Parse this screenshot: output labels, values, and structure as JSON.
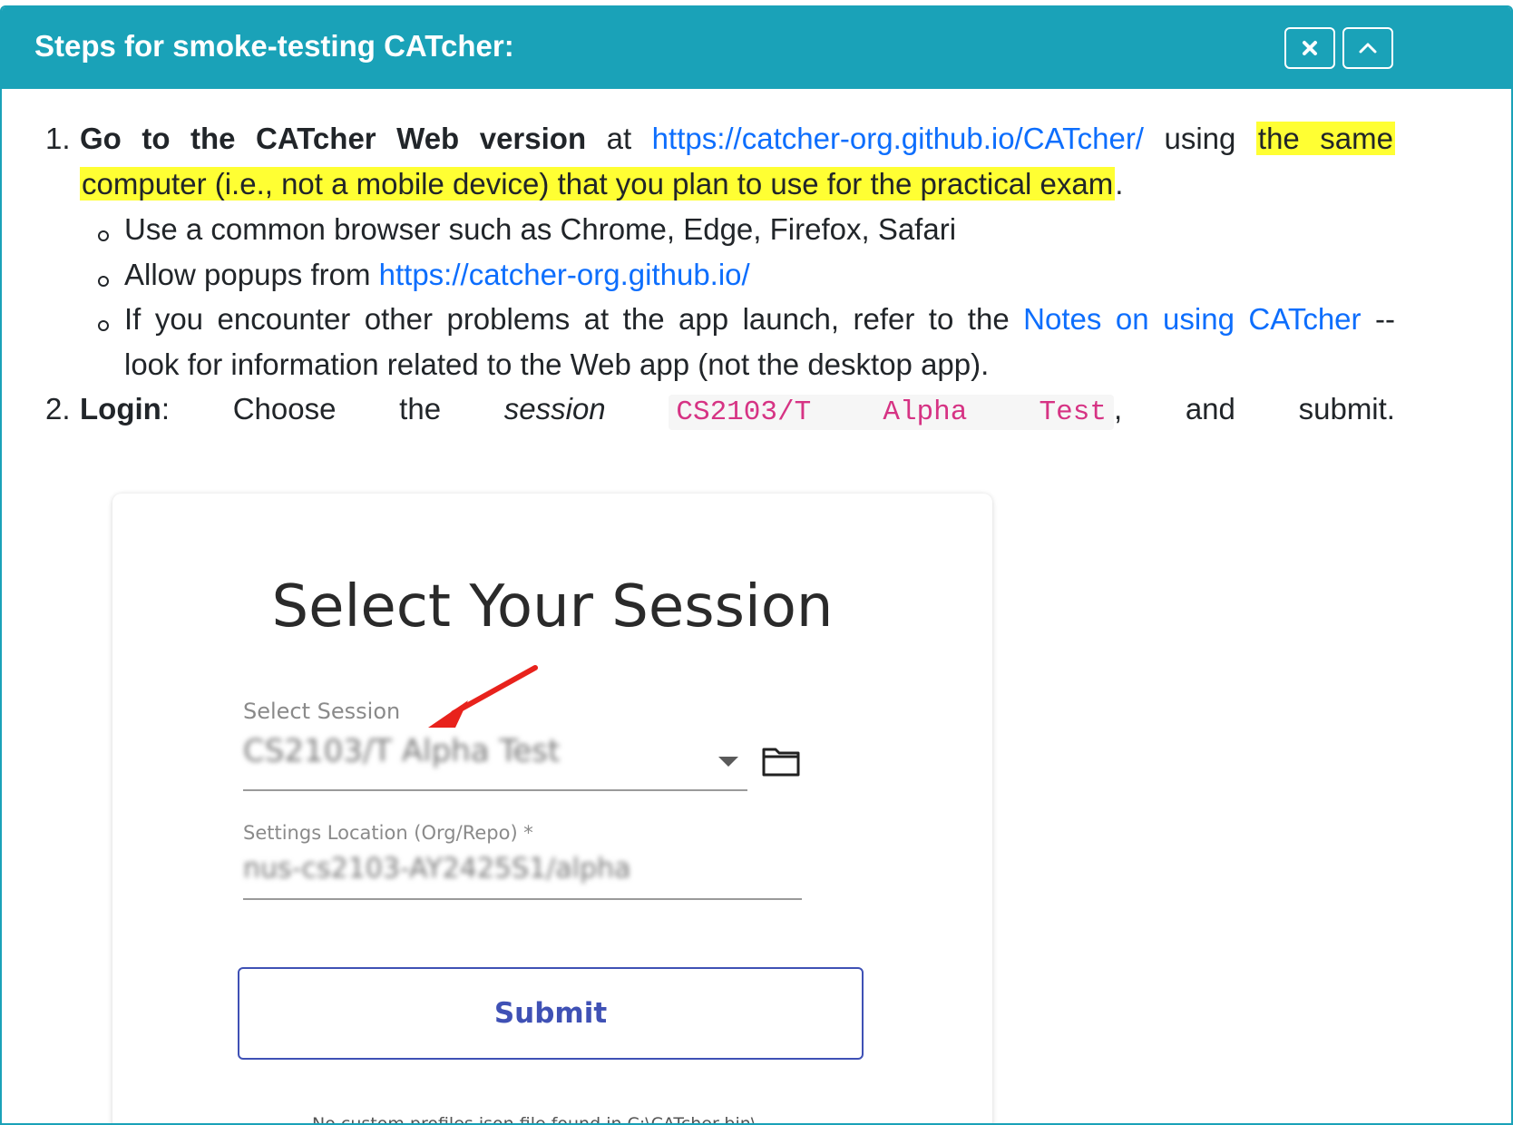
{
  "panel": {
    "title": "Steps for smoke-testing CATcher:",
    "close_icon": "close-icon",
    "collapse_icon": "chevron-up-icon",
    "header_color": "#1aa2b8"
  },
  "step1": {
    "number": "1.",
    "bold": "Go to the CATcher Web version",
    "at": "at",
    "link": "https://catcher-org.github.io/CATcher/",
    "using": "using",
    "highlight_part1": "the same",
    "highlight_part2": "computer (i.e., not a mobile device) that you plan to use for the practical exam",
    "period": ".",
    "bullets": {
      "b1": "Use a common browser such as Chrome, Edge, Firefox, Safari",
      "b2_text": "Allow popups from",
      "b2_link": "https://catcher-org.github.io/",
      "b3_text": "If you encounter other problems at the app launch, refer to the",
      "b3_link": "Notes on using CATcher",
      "b3_dash": "--",
      "b3_cont": "look for information related to the Web app (not the desktop app)."
    }
  },
  "step2": {
    "number": "2.",
    "bold": "Login",
    "colon": ":",
    "choose": "Choose",
    "the": "the",
    "session_word": "session",
    "code": "CS2103/T Alpha Test",
    "comma": ",",
    "and": "and",
    "submit": "submit."
  },
  "screenshot": {
    "title": "Select Your Session",
    "session_label": "Select Session",
    "session_value": "CS2103/T Alpha Test",
    "settings_label": "Settings Location (Org/Repo) *",
    "settings_value": "nus-cs2103-AY2425S1/alpha",
    "submit_label": "Submit",
    "footnote": "No custom profiles.json file found in C:\\CATcher-bin\\"
  },
  "colors": {
    "link": "#0d6efd",
    "highlight": "#ffff33",
    "code": "#d63384",
    "submit": "#3f51b5",
    "arrow": "#e8221c"
  }
}
